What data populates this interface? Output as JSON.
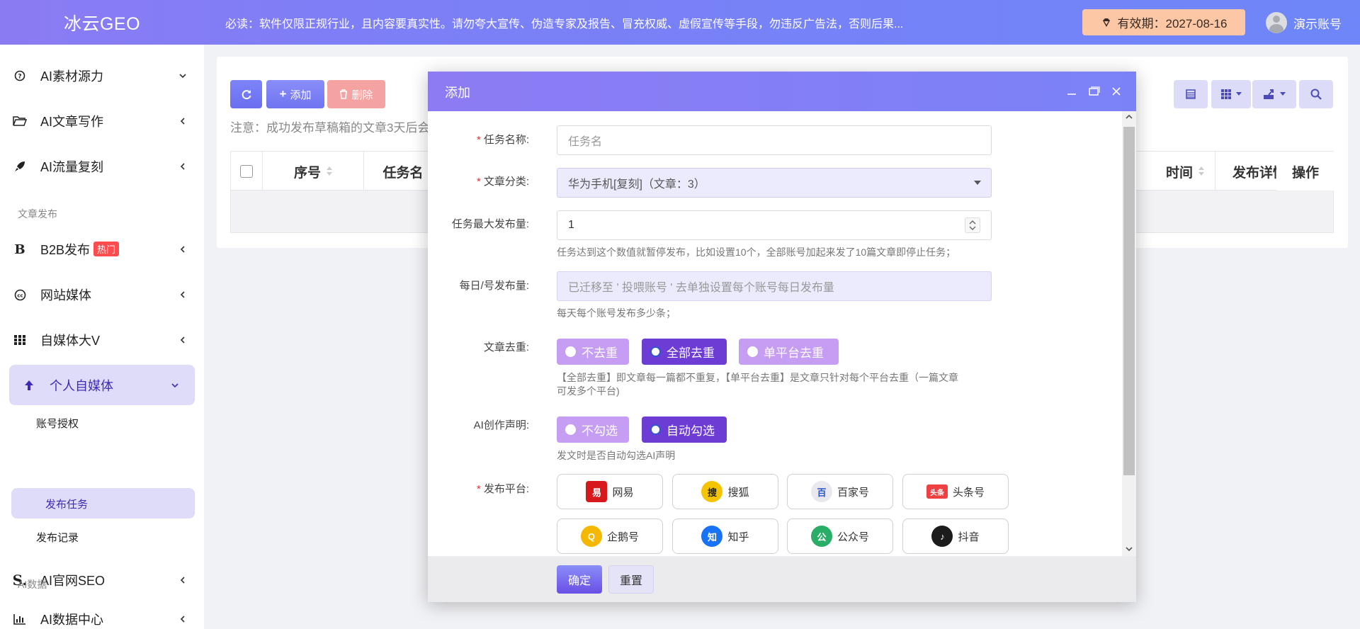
{
  "header": {
    "logo": "冰云GEO",
    "notice": "必读：软件仅限正规行业，且内容要真实性。请勿夸大宣传、伪造专家及报告、冒充权威、虚假宣传等手段，勿违反广告法，否则后果...",
    "expiry": "有效期：2027-08-16",
    "user_name": "演示账号"
  },
  "sidebar": {
    "items": [
      {
        "label": "AI素材源力",
        "icon": "question-circle-icon"
      },
      {
        "label": "AI文章写作",
        "icon": "folder-open-icon"
      },
      {
        "label": "AI流量复刻",
        "icon": "rocket-icon"
      },
      {
        "section": "文章发布"
      },
      {
        "label": "B2B发布",
        "badge": "热门",
        "icon": "bold-b-icon"
      },
      {
        "label": "网站媒体",
        "icon": "cc-icon"
      },
      {
        "label": "自媒体大V",
        "icon": "grid-icon"
      },
      {
        "label": "个人自媒体",
        "icon": "arrow-up-icon",
        "active": true
      },
      {
        "section": "AI数据"
      }
    ],
    "sub_items": [
      "账号授权",
      "发布任务",
      "发布记录"
    ],
    "item_seo": "AI官网SEO",
    "item_data": "AI数据中心",
    "section_publish": "文章发布",
    "section_data": "AI数据",
    "b2b_label": "B2B发布",
    "b2b_badge": "热门"
  },
  "toolbar": {
    "add_label": "添加",
    "delete_label": "删除",
    "tip": "注意：成功发布草稿箱的文章3天后会"
  },
  "table": {
    "columns": [
      "序号",
      "任务名",
      "时间",
      "发布详情",
      "操作"
    ]
  },
  "modal": {
    "title": "添加",
    "fields": {
      "task_name_label": "任务名称:",
      "task_name_placeholder": "任务名",
      "category_label": "文章分类:",
      "category_value": "华为手机[复刻]（文章：3）",
      "max_label": "任务最大发布量:",
      "max_value": "1",
      "max_help": "任务达到这个数值就暂停发布，比如设置10个，全部账号加起来发了10篇文章即停止任务；",
      "daily_label": "每日/号发布量:",
      "daily_value": "已迁移至 ' 投喂账号 ' 去单独设置每个账号每日发布量",
      "daily_help": "每天每个账号发布多少条；",
      "dedup_label": "文章去重:",
      "dedup_options": [
        "不去重",
        "全部去重",
        "单平台去重"
      ],
      "dedup_selected": "全部去重",
      "dedup_help_1": "【全部去重】即文章每一篇都不重复，【单平台去重】是文章只针对每个平台去重（一篇文章",
      "dedup_help_2": "可发多个平台)",
      "ai_label": "AI创作声明:",
      "ai_options": [
        "不勾选",
        "自动勾选"
      ],
      "ai_selected": "自动勾选",
      "ai_help": "发文时是否自动勾选AI声明",
      "platform_label": "发布平台:",
      "platforms": [
        {
          "name": "网易",
          "icon": "netease-icon",
          "color": "#d7191d",
          "glyph": "易"
        },
        {
          "name": "搜狐",
          "icon": "sohu-icon",
          "color": "#f5c400",
          "glyph": "搜"
        },
        {
          "name": "百家号",
          "icon": "baijiahao-icon",
          "color": "#e8e8ee",
          "glyph": "百"
        },
        {
          "name": "头条号",
          "icon": "toutiao-icon",
          "color": "#f04142",
          "glyph": "头条"
        },
        {
          "name": "企鹅号",
          "icon": "qie-icon",
          "color": "#f5b800",
          "glyph": "Q"
        },
        {
          "name": "知乎",
          "icon": "zhihu-icon",
          "color": "#1772f6",
          "glyph": "知"
        },
        {
          "name": "公众号",
          "icon": "wechat-mp-icon",
          "color": "#2aae67",
          "glyph": "公"
        },
        {
          "name": "抖音",
          "icon": "douyin-icon",
          "color": "#1c1c1c",
          "glyph": "♪"
        }
      ]
    },
    "confirm_label": "确定",
    "reset_label": "重置"
  },
  "colors": {
    "accent": "#7c7ff6",
    "radio_selected": "#6d3cd4",
    "radio_unselected": "#c59df2",
    "required": "#e5322d",
    "hot_badge": "#ff4d4f"
  }
}
